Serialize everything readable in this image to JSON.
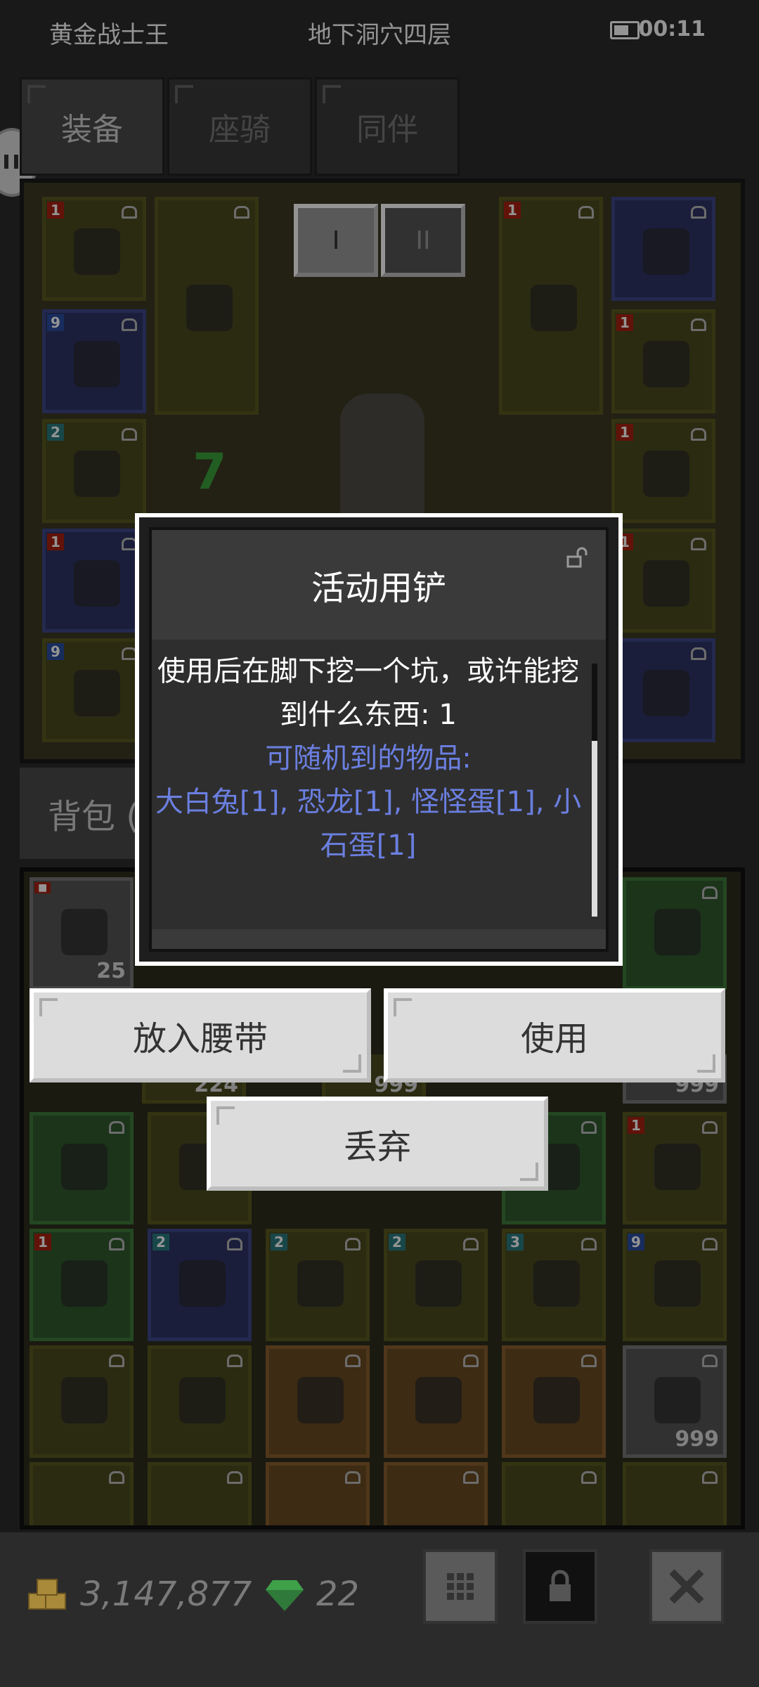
{
  "status": {
    "character": "黄金战士王",
    "location": "地下洞穴四层",
    "time": "00:11"
  },
  "tabs": [
    "装备",
    "座骑",
    "同伴"
  ],
  "equip_slots": [
    {
      "lvl": "1",
      "tier": "r"
    },
    {
      "lvl": "",
      "tier": ""
    },
    {
      "lvl": "1",
      "tier": "r"
    },
    {
      "lvl": "",
      "tier": ""
    },
    {
      "lvl": "9",
      "tier": "b"
    },
    {
      "lvl": "1",
      "tier": "r"
    },
    {
      "lvl": "2",
      "tier": "t"
    },
    {
      "lvl": "1",
      "tier": "r"
    },
    {
      "lvl": "1",
      "tier": "r"
    },
    {
      "lvl": "1",
      "tier": "r"
    },
    {
      "lvl": "9",
      "tier": "b"
    }
  ],
  "equip_panel": {
    "set_buttons": [
      "I",
      "II"
    ],
    "level_number": "7"
  },
  "bag": {
    "tab_label": "背包 (",
    "counts": [
      "25",
      "224",
      "999",
      "999",
      "999"
    ]
  },
  "dialog": {
    "title": "活动用铲",
    "description": "使用后在脚下挖一个坑，或许能挖到什么东西: 1",
    "random_label": "可随机到的物品:",
    "random_items": "大白兔[1], 恐龙[1], 怪怪蛋[1], 小石蛋[1]"
  },
  "actions": {
    "belt": "放入腰带",
    "use": "使用",
    "discard": "丢弃"
  },
  "currency": {
    "gold": "3,147,877",
    "gems": "22"
  },
  "colors": {
    "accent_text": "#6b7fe0",
    "dialog_bg": "#2e2e2e",
    "button_bg": "#dcdcdc"
  }
}
